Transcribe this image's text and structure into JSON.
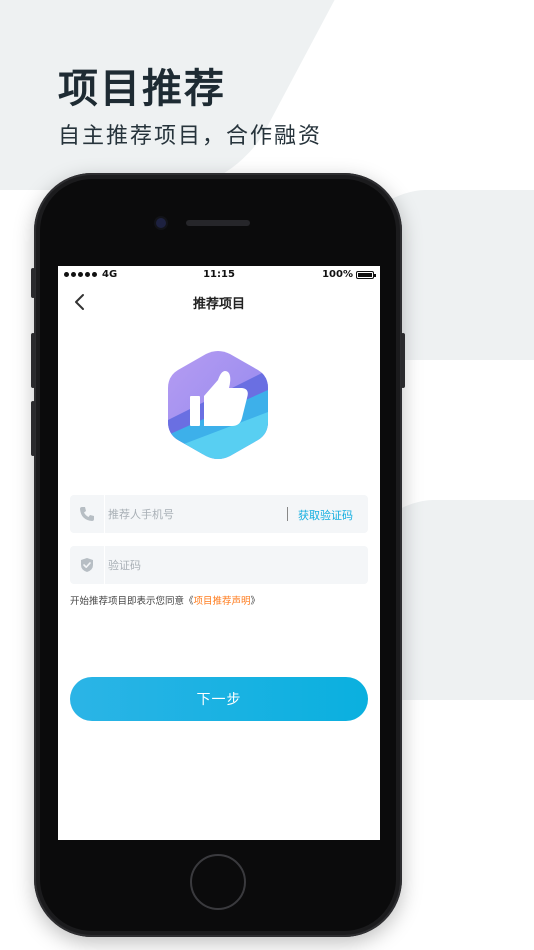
{
  "promo": {
    "title": "项目推荐",
    "subtitle": "自主推荐项目，合作融资"
  },
  "status_bar": {
    "carrier": "4G",
    "time": "11:15",
    "battery": "100%",
    "battery_level": 1.0
  },
  "nav": {
    "title": "推荐项目",
    "back_icon": "chevron-left-icon"
  },
  "logo": {
    "icon": "thumbs-up-icon",
    "colors": [
      "#9b8cf0",
      "#5d6be0",
      "#3fb6ea",
      "#5dd3f2"
    ]
  },
  "form": {
    "phone": {
      "placeholder": "推荐人手机号",
      "value": "",
      "icon": "phone-icon"
    },
    "get_code_label": "获取验证码",
    "code": {
      "placeholder": "验证码",
      "value": "",
      "icon": "shield-check-icon"
    }
  },
  "agreement": {
    "prefix": "开始推荐项目即表示您同意《",
    "link": "项目推荐声明",
    "suffix": "》"
  },
  "next_button": {
    "label": "下一步"
  },
  "colors": {
    "accent": "#13aee0",
    "link": "#ff7a1a",
    "title": "#1e2b33"
  }
}
